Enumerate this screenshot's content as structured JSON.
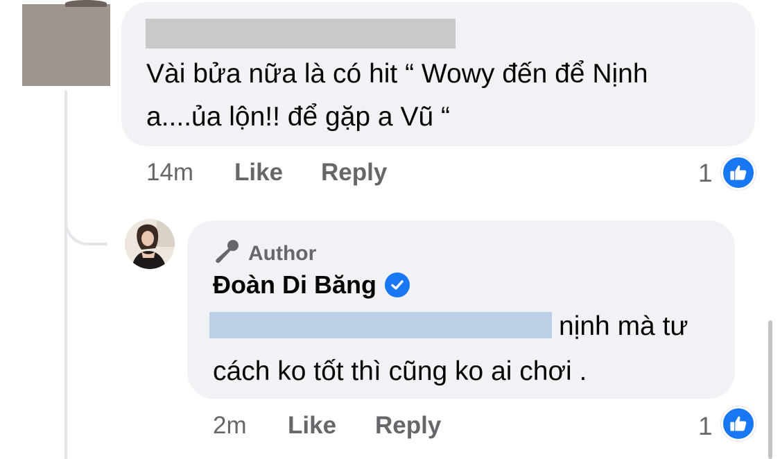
{
  "comments": [
    {
      "text_line1": "Vài bửa nữa là có hit “ Wowy đến để Nịnh",
      "text_line2": "a....ủa lộn!! để gặp a Vũ “",
      "time": "14m",
      "like_label": "Like",
      "reply_label": "Reply",
      "reaction_count": "1",
      "reaction_icon": "thumbs-up-icon"
    }
  ],
  "reply": {
    "badge_label": "Author",
    "badge_icon": "microphone-icon",
    "author_name": "Đoàn Di Băng",
    "verified_icon": "verified-check-icon",
    "text_line1": "nịnh mà tư",
    "text_line2": "cách ko tốt thì cũng ko ai chơi .",
    "time": "2m",
    "like_label": "Like",
    "reply_label": "Reply",
    "reaction_count": "1",
    "reaction_icon": "thumbs-up-icon"
  },
  "colors": {
    "bubble": "#f0f2f5",
    "meta_text": "#65676b",
    "facebook_blue": "#1877f2",
    "redaction_gray": "#c9c9cb",
    "redaction_blue": "#bccfe6"
  }
}
